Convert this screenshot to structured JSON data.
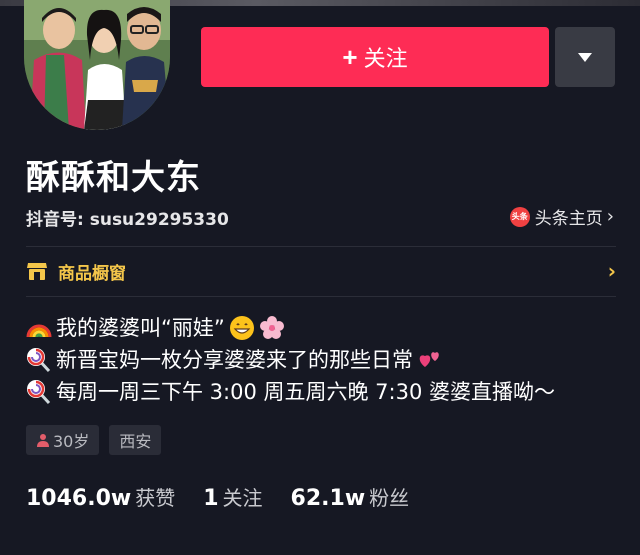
{
  "profile": {
    "name": "酥酥和大东",
    "uid": "抖音号: susu29295330",
    "toutiao_label": "头条主页",
    "toutiao_badge": "头条"
  },
  "actions": {
    "follow_label": "关注",
    "follow_plus": "+"
  },
  "shop": {
    "label": "商品橱窗"
  },
  "bio": {
    "line1": "我的婆婆叫“丽娃”",
    "line2": "新晋宝妈一枚分享婆婆来了的那些日常",
    "line3": "每周一周三下午 3:00 周五周六晚 7:30 婆婆直播呦～"
  },
  "tags": {
    "age": "30岁",
    "city": "西安"
  },
  "stats": {
    "likes_num": "1046.0w",
    "likes_label": "获赞",
    "following_num": "1",
    "following_label": "关注",
    "fans_num": "62.1w",
    "fans_label": "粉丝"
  },
  "colors": {
    "background": "#161823",
    "follow_button": "#fe2c55",
    "shop_accent": "#f4c64a",
    "tag_bg": "#2a2c37"
  },
  "icons": [
    "avatar",
    "caret-down-icon",
    "toutiao-icon",
    "chevron-right-icon",
    "shop-icon",
    "rainbow-icon",
    "grin-icon",
    "cherry-blossom-icon",
    "lollipop-icon",
    "two-hearts-icon",
    "person-icon"
  ]
}
